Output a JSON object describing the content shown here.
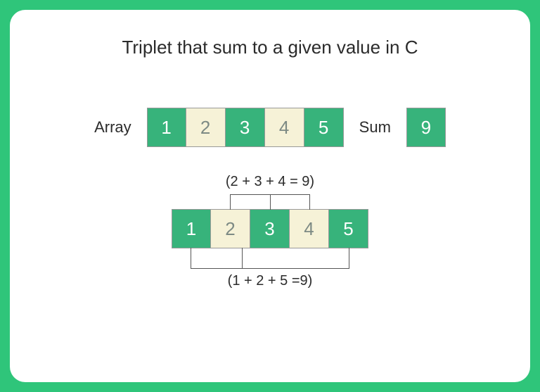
{
  "title": "Triplet that sum to a given value in C",
  "labels": {
    "array": "Array",
    "sum": "Sum"
  },
  "array_values": [
    "1",
    "2",
    "3",
    "4",
    "5"
  ],
  "array_highlight": [
    false,
    true,
    false,
    true,
    false
  ],
  "sum_value": "9",
  "equation_top": "(2 + 3 + 4 = 9)",
  "lower_array_values": [
    "1",
    "2",
    "3",
    "4",
    "5"
  ],
  "lower_array_highlight": [
    false,
    true,
    false,
    true,
    false
  ],
  "equation_bottom": "(1 + 2 + 5 =9)",
  "colors": {
    "accent": "#37b37b",
    "highlight": "#f6f2d7",
    "frame": "#2fc57a"
  }
}
